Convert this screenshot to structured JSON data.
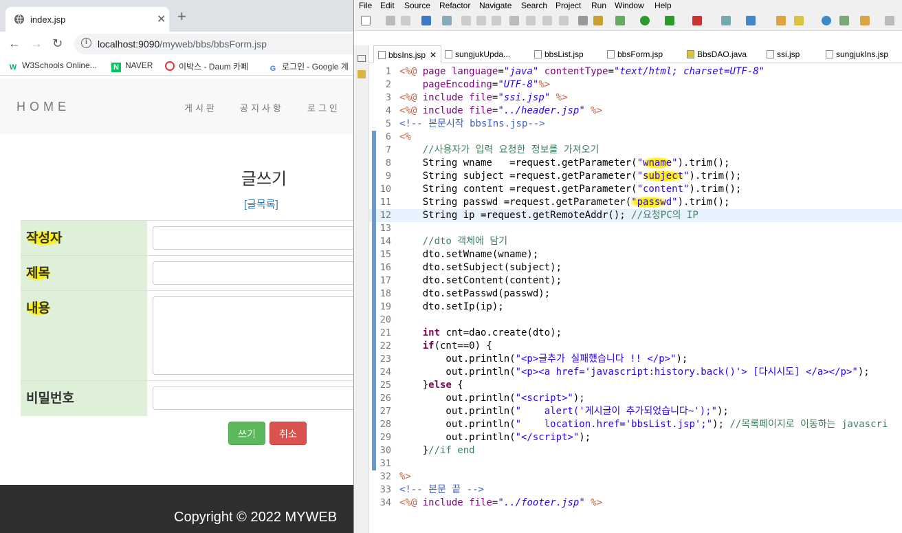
{
  "browser": {
    "tab_title": "index.jsp",
    "url_host": "localhost:9090",
    "url_path": "/myweb/bbs/bbsForm.jsp",
    "bookmarks": [
      "W3Schools Online...",
      "NAVER",
      "이박스 - Daum 카페",
      "로그인 - Google 계"
    ],
    "site": {
      "brand": "HOME",
      "nav": [
        "게시판",
        "공지사항",
        "로그인"
      ],
      "page_title": "글쓰기",
      "list_link": "[글목록]",
      "fields": {
        "writer": "작성자",
        "subject": "제목",
        "content": "내용",
        "password": "비밀번호"
      },
      "submit": "쓰기",
      "cancel": "취소",
      "footer": "Copyright © 2022 MYWEB"
    }
  },
  "eclipse": {
    "menu": [
      "File",
      "Edit",
      "Source",
      "Refactor",
      "Navigate",
      "Search",
      "Project",
      "Run",
      "Window",
      "Help"
    ],
    "tabs": [
      "bbsIns.jsp",
      "sungjukUpda...",
      "bbsList.jsp",
      "bbsForm.jsp",
      "BbsDAO.java",
      "ssi.jsp",
      "sungjukIns.jsp"
    ],
    "line_numbers": [
      "1",
      "2",
      "3",
      "4",
      "5",
      "6",
      "7",
      "8",
      "9",
      "10",
      "11",
      "12",
      "13",
      "14",
      "15",
      "16",
      "17",
      "18",
      "19",
      "20",
      "21",
      "22",
      "23",
      "24",
      "25",
      "26",
      "27",
      "28",
      "29",
      "30",
      "31",
      "32",
      "33",
      "34"
    ]
  }
}
